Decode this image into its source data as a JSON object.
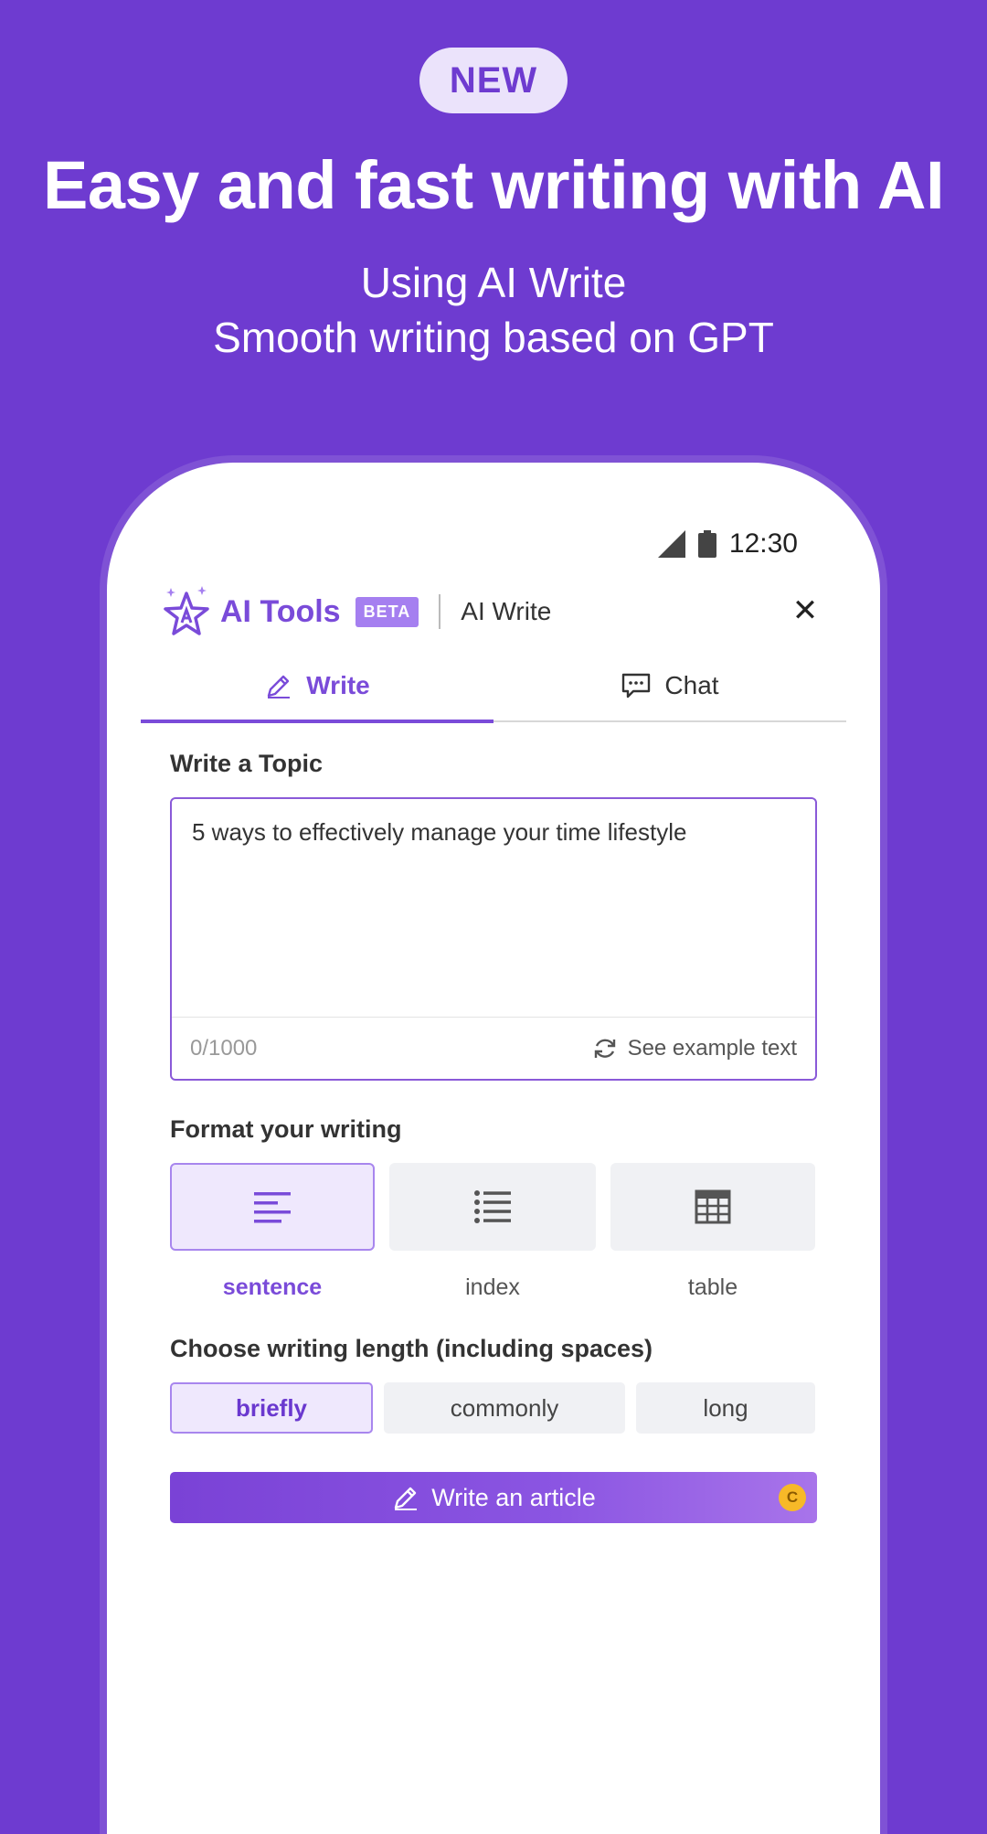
{
  "promo": {
    "badge": "NEW",
    "headline": "Easy and fast writing with AI",
    "subline_1": "Using AI Write",
    "subline_2": "Smooth writing based on GPT"
  },
  "status_bar": {
    "time": "12:30"
  },
  "header": {
    "brand": "AI Tools",
    "beta_badge": "BETA",
    "section": "AI Write",
    "close_icon": "close-icon"
  },
  "tabs": [
    {
      "label": "Write",
      "icon": "pencil-icon",
      "active": true
    },
    {
      "label": "Chat",
      "icon": "chat-bubble-icon",
      "active": false
    }
  ],
  "topic": {
    "label": "Write a Topic",
    "value": "5 ways to effectively manage your time lifestyle",
    "counter": "0/1000",
    "example_link": "See example text"
  },
  "format": {
    "label": "Format your writing",
    "options": [
      {
        "label": "sentence",
        "icon": "align-left-icon",
        "selected": true
      },
      {
        "label": "index",
        "icon": "list-icon",
        "selected": false
      },
      {
        "label": "table",
        "icon": "table-icon",
        "selected": false
      }
    ]
  },
  "length": {
    "label": "Choose writing length (including spaces)",
    "options": [
      {
        "label": "briefly",
        "selected": true
      },
      {
        "label": "commonly",
        "selected": false
      },
      {
        "label": "long",
        "selected": false
      }
    ]
  },
  "cta": {
    "label": "Write an article",
    "coin": "C"
  },
  "colors": {
    "brand": "#6e3bd0",
    "accent": "#7a4bd9",
    "selected_bg": "#efe8fd",
    "coin": "#f7b928"
  }
}
